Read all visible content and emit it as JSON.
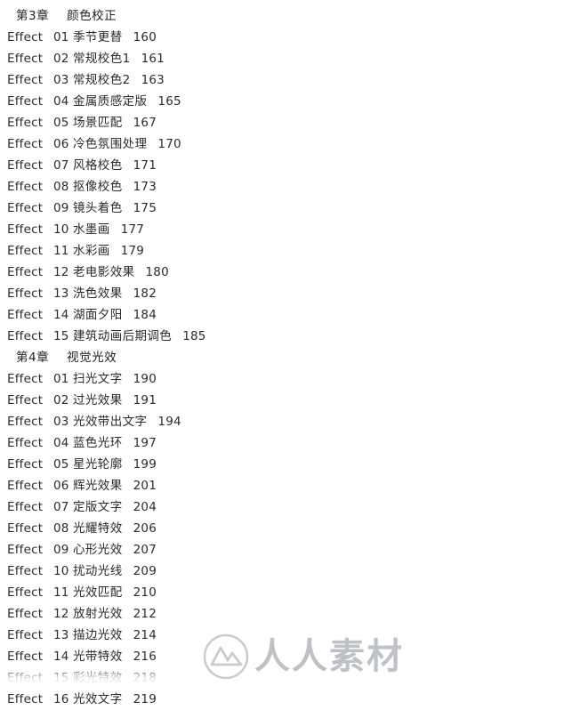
{
  "document": {
    "type": "table-of-contents",
    "rows": [
      {
        "kind": "chapter",
        "label": "第3章",
        "title": "颜色校正"
      },
      {
        "kind": "entry",
        "prefix": "Effect",
        "num": "01",
        "title": "季节更替",
        "page": "160"
      },
      {
        "kind": "entry",
        "prefix": "Effect",
        "num": "02",
        "title": "常规校色1",
        "page": "161"
      },
      {
        "kind": "entry",
        "prefix": "Effect",
        "num": "03",
        "title": "常规校色2",
        "page": "163"
      },
      {
        "kind": "entry",
        "prefix": "Effect",
        "num": "04",
        "title": "金属质感定版",
        "page": "165"
      },
      {
        "kind": "entry",
        "prefix": "Effect",
        "num": "05",
        "title": "场景匹配",
        "page": "167"
      },
      {
        "kind": "entry",
        "prefix": "Effect",
        "num": "06",
        "title": "冷色氛围处理",
        "page": "170"
      },
      {
        "kind": "entry",
        "prefix": "Effect",
        "num": "07",
        "title": "风格校色",
        "page": "171"
      },
      {
        "kind": "entry",
        "prefix": "Effect",
        "num": "08",
        "title": "抠像校色",
        "page": "173"
      },
      {
        "kind": "entry",
        "prefix": "Effect",
        "num": "09",
        "title": "镜头着色",
        "page": "175"
      },
      {
        "kind": "entry",
        "prefix": "Effect",
        "num": "10",
        "title": "水墨画",
        "page": "177"
      },
      {
        "kind": "entry",
        "prefix": "Effect",
        "num": "11",
        "title": "水彩画",
        "page": "179"
      },
      {
        "kind": "entry",
        "prefix": "Effect",
        "num": "12",
        "title": "老电影效果",
        "page": "180"
      },
      {
        "kind": "entry",
        "prefix": "Effect",
        "num": "13",
        "title": "洗色效果",
        "page": "182"
      },
      {
        "kind": "entry",
        "prefix": "Effect",
        "num": "14",
        "title": "湖面夕阳",
        "page": "184"
      },
      {
        "kind": "entry",
        "prefix": "Effect",
        "num": "15",
        "title": "建筑动画后期调色",
        "page": "185"
      },
      {
        "kind": "chapter",
        "label": "第4章",
        "title": "视觉光效"
      },
      {
        "kind": "entry",
        "prefix": "Effect",
        "num": "01",
        "title": "扫光文字",
        "page": "190"
      },
      {
        "kind": "entry",
        "prefix": "Effect",
        "num": "02",
        "title": "过光效果",
        "page": "191"
      },
      {
        "kind": "entry",
        "prefix": "Effect",
        "num": "03",
        "title": "光效带出文字",
        "page": "194"
      },
      {
        "kind": "entry",
        "prefix": "Effect",
        "num": "04",
        "title": "蓝色光环",
        "page": "197"
      },
      {
        "kind": "entry",
        "prefix": "Effect",
        "num": "05",
        "title": "星光轮廓",
        "page": "199"
      },
      {
        "kind": "entry",
        "prefix": "Effect",
        "num": "06",
        "title": "辉光效果",
        "page": "201"
      },
      {
        "kind": "entry",
        "prefix": "Effect",
        "num": "07",
        "title": "定版文字",
        "page": "204"
      },
      {
        "kind": "entry",
        "prefix": "Effect",
        "num": "08",
        "title": "光耀特效",
        "page": "206"
      },
      {
        "kind": "entry",
        "prefix": "Effect",
        "num": "09",
        "title": "心形光效",
        "page": "207"
      },
      {
        "kind": "entry",
        "prefix": "Effect",
        "num": "10",
        "title": "扰动光线",
        "page": "209"
      },
      {
        "kind": "entry",
        "prefix": "Effect",
        "num": "11",
        "title": "光效匹配",
        "page": "210"
      },
      {
        "kind": "entry",
        "prefix": "Effect",
        "num": "12",
        "title": "放射光效",
        "page": "212"
      },
      {
        "kind": "entry",
        "prefix": "Effect",
        "num": "13",
        "title": "描边光效",
        "page": "214"
      },
      {
        "kind": "entry",
        "prefix": "Effect",
        "num": "14",
        "title": "光带特效",
        "page": "216"
      },
      {
        "kind": "entry",
        "prefix": "Effect",
        "num": "15",
        "title": "彩光特效",
        "page": "218"
      },
      {
        "kind": "entry",
        "prefix": "Effect",
        "num": "16",
        "title": "光效文字",
        "page": "219"
      }
    ]
  },
  "watermark": {
    "text": "人人素材",
    "logo_icon": "mountain-logo-icon",
    "color": "#b9bdc2"
  }
}
